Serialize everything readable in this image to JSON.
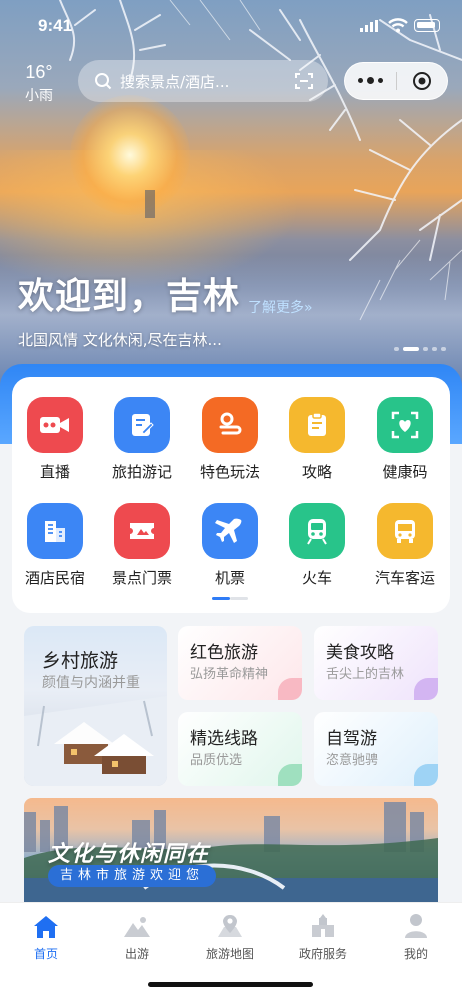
{
  "status": {
    "time": "9:41"
  },
  "weather": {
    "temp": "16°",
    "condition": "小雨"
  },
  "search": {
    "placeholder": "搜索景点/酒店..."
  },
  "hero": {
    "title": "欢迎到，吉林",
    "more_link": "了解更多»",
    "subtitle": "北国风情 文化休闲,尽在吉林..."
  },
  "grid": [
    {
      "label": "直播",
      "icon": "video-camera-icon",
      "color": "#ee4a4f"
    },
    {
      "label": "旅拍游记",
      "icon": "note-edit-icon",
      "color": "#3c86f5"
    },
    {
      "label": "特色玩法",
      "icon": "location-route-icon",
      "color": "#f46a24"
    },
    {
      "label": "攻略",
      "icon": "guide-doc-icon",
      "color": "#f5b82e"
    },
    {
      "label": "健康码",
      "icon": "health-scan-icon",
      "color": "#28c48a"
    },
    {
      "label": "酒店民宿",
      "icon": "hotel-building-icon",
      "color": "#3c86f5"
    },
    {
      "label": "景点门票",
      "icon": "ticket-icon",
      "color": "#ee4a4f"
    },
    {
      "label": "机票",
      "icon": "airplane-icon",
      "color": "#3c86f5"
    },
    {
      "label": "火车",
      "icon": "train-icon",
      "color": "#28c48a"
    },
    {
      "label": "汽车客运",
      "icon": "bus-icon",
      "color": "#f5b82e"
    }
  ],
  "features": {
    "village": {
      "title": "乡村旅游",
      "sub": "颜值与内涵并重"
    },
    "red": {
      "title": "红色旅游",
      "sub": "弘扬革命精神"
    },
    "food": {
      "title": "美食攻略",
      "sub": "舌尖上的吉林"
    },
    "route": {
      "title": "精选线路",
      "sub": "品质优选"
    },
    "drive": {
      "title": "自驾游",
      "sub": "恣意驰骋"
    }
  },
  "banner": {
    "title": "文化与休闲同在",
    "sub": "吉林市旅游欢迎您"
  },
  "tabs": [
    {
      "label": "首页",
      "icon": "home-icon",
      "active": true
    },
    {
      "label": "出游",
      "icon": "mountain-icon",
      "active": false
    },
    {
      "label": "旅游地图",
      "icon": "map-pin-icon",
      "active": false
    },
    {
      "label": "政府服务",
      "icon": "government-building-icon",
      "active": false
    },
    {
      "label": "我的",
      "icon": "user-icon",
      "active": false
    }
  ]
}
